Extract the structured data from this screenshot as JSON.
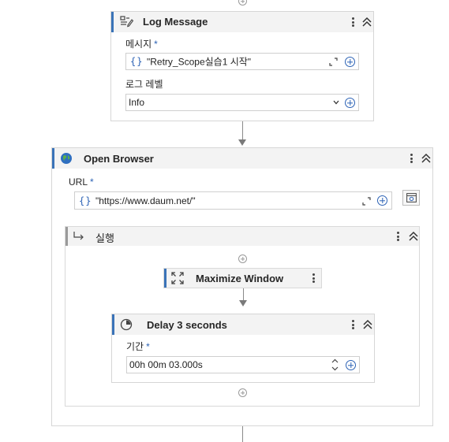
{
  "log_message": {
    "title": "Log Message",
    "message_label": "메시지",
    "required_mark": "*",
    "message_value": "\"Retry_Scope실습1 시작\"",
    "expr_brace": "{}",
    "level_label": "로그 레벨",
    "level_value": "Info"
  },
  "open_browser": {
    "title": "Open Browser",
    "url_label": "URL",
    "required_mark": "*",
    "url_value": "\"https://www.daum.net/\"",
    "expr_brace": "{}"
  },
  "sequence": {
    "title": "실행"
  },
  "maximize_window": {
    "title": "Maximize Window"
  },
  "delay": {
    "title": "Delay 3 seconds",
    "duration_label": "기간",
    "required_mark": "*",
    "duration_value": "00h 00m 03.000s"
  },
  "colors": {
    "accent": "#2c62b5",
    "header_bg": "#f3f3f3",
    "border": "#d6d6d6"
  },
  "icons": [
    "log-message-icon",
    "globe-icon",
    "maximize-icon",
    "delay-clock-icon",
    "branch-arrow-icon",
    "browser-window-icon"
  ]
}
